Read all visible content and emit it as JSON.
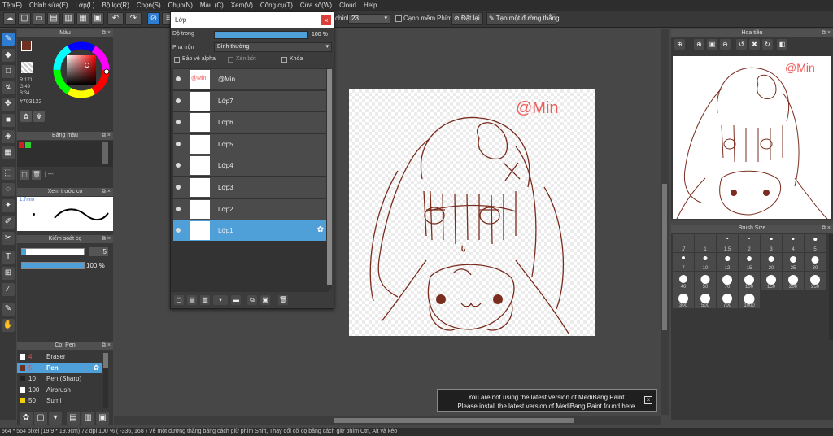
{
  "menu": [
    "Tệp(F)",
    "Chỉnh sửa(E)",
    "Lớp(L)",
    "Bộ lọc(R)",
    "Chọn(S)",
    "Chụp(N)",
    "Màu (C)",
    "Xem(V)",
    "Công cụ(T)",
    "Cửa sổ(W)",
    "Cloud",
    "Help"
  ],
  "toolbar": {
    "tinh_label": "chỉnh",
    "tinh_value": "23",
    "canh_mem": "Cạnh mềm",
    "phim": "Phím",
    "dat_lai": "Đặt lại",
    "tao_duong": "Tạo một đường thẳng"
  },
  "color_panel": {
    "title": "Màu",
    "r": "R:171",
    "g": "G:49",
    "b": "B:34",
    "hex": "#703122",
    "accent": "#703122"
  },
  "swatch_panel": {
    "title": "Bảng màu",
    "list_text": "| ---"
  },
  "brush_preview": {
    "title": "Xem trước cọ",
    "size": "1.7mm"
  },
  "brush_control": {
    "title": "Kiểm soát cọ",
    "size_value": "5",
    "opacity_value": "100 %"
  },
  "pen_panel": {
    "title": "Cọ: Pen",
    "items": [
      {
        "size": "4",
        "name": "Eraser",
        "color": "#ffffff",
        "sel": false
      },
      {
        "size": "5",
        "name": "Pen",
        "color": "#703122",
        "sel": true
      },
      {
        "size": "10",
        "name": "Pen (Sharp)",
        "color": "#222222",
        "sel": false
      },
      {
        "size": "100",
        "name": "Airbrush",
        "color": "#ffffff",
        "sel": false
      },
      {
        "size": "50",
        "name": "Sumi",
        "color": "#f0d000",
        "sel": false
      }
    ]
  },
  "layer_window": {
    "title": "Lớp",
    "opacity_label": "Độ trong",
    "opacity_value": "100 %",
    "blend_label": "Pha trộn",
    "blend_value": "Bình thường",
    "protect_alpha": "Bảo vệ alpha",
    "clipping": "Xén bớt",
    "lock": "Khóa",
    "layers": [
      {
        "name": "@Min",
        "sel": false
      },
      {
        "name": "Lớp7",
        "sel": false
      },
      {
        "name": "Lớp6",
        "sel": false
      },
      {
        "name": "Lớp5",
        "sel": false
      },
      {
        "name": "Lớp4",
        "sel": false
      },
      {
        "name": "Lớp3",
        "sel": false
      },
      {
        "name": "Lớp2",
        "sel": false
      },
      {
        "name": "Lớp1",
        "sel": true
      }
    ]
  },
  "canvas": {
    "watermark": "@Min",
    "line_color": "#7a2c1e",
    "watermark_color": "#f05a5a"
  },
  "navigator": {
    "title": "Hoa tiêu",
    "watermark": "@Min"
  },
  "brush_size": {
    "title": "Brush Size",
    "sizes": [
      ".7",
      "1",
      "1.5",
      "2",
      "3",
      "4",
      "5",
      "7",
      "10",
      "12",
      "15",
      "20",
      "25",
      "30",
      "40",
      "50",
      "70",
      "100",
      "150",
      "200",
      "250",
      "300",
      "500",
      "700",
      "1000"
    ]
  },
  "notice": {
    "line1": "You are not using the latest version of MediBang Paint.",
    "line2": "Please install the latest version of MediBang Paint found here."
  },
  "status": "564 * 564 pixel   (19.9 * 19.9cm)   72 dpi   100 %   ( -336, 168 )   Vẽ một đường thẳng bằng cách giữ phím Shift, Thay đổi cỡ cọ bằng cách giữ phím Ctrl, Alt và kéo"
}
